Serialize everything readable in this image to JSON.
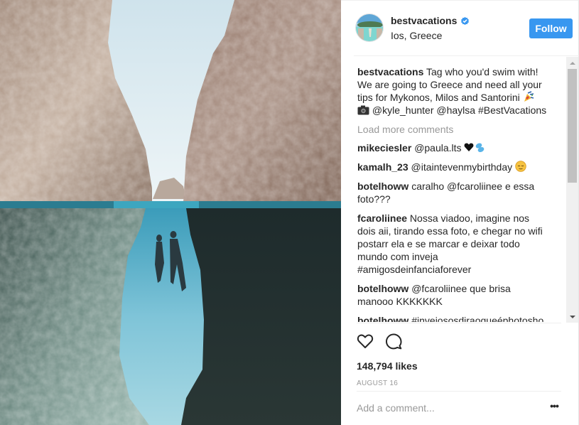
{
  "post": {
    "photo_alt": "Two people floating underwater between rocky cliffs",
    "author": {
      "username": "bestvacations",
      "verified": true,
      "location": "Ios, Greece"
    },
    "follow_label": "Follow",
    "caption": {
      "author": "bestvacations",
      "text": "Tag who you'd swim with! We are going to Greece and need all your tips for Mykonos, Milos and Santorini",
      "emoji_1": "party-popper",
      "emoji_2": "camera",
      "tags": "@kyle_hunter @haylsa #BestVacations"
    },
    "load_more_label": "Load more comments",
    "comments": [
      {
        "author": "mikeciesler",
        "text": "@paula.lts",
        "emoji": "black-heart sweat-droplets"
      },
      {
        "author": "kamalh_23",
        "text": "@itaintevenmybirthday",
        "emoji": "relieved-face"
      },
      {
        "author": "botelhoww",
        "text": "caralho @fcaroliinee e essa foto???"
      },
      {
        "author": "fcaroliinee",
        "text": "Nossa viadoo, imagine nos dois aii, tirando essa foto, e chegar no wifi postarr ela e se marcar e deixar todo mundo com inveja #amigosdeinfanciaforever"
      },
      {
        "author": "botelhoww",
        "text": "@fcaroliinee que brisa manooo KKKKKKK"
      },
      {
        "author": "botelhoww",
        "text": "#invejososdiraoqueéphotoshop"
      }
    ],
    "likes": "148,794 likes",
    "date": "AUGUST 16",
    "comment_placeholder": "Add a comment...",
    "more_label": "•••"
  },
  "colors": {
    "accent": "#3897f0",
    "text": "#262626",
    "muted": "#999999",
    "border": "#efefef"
  }
}
